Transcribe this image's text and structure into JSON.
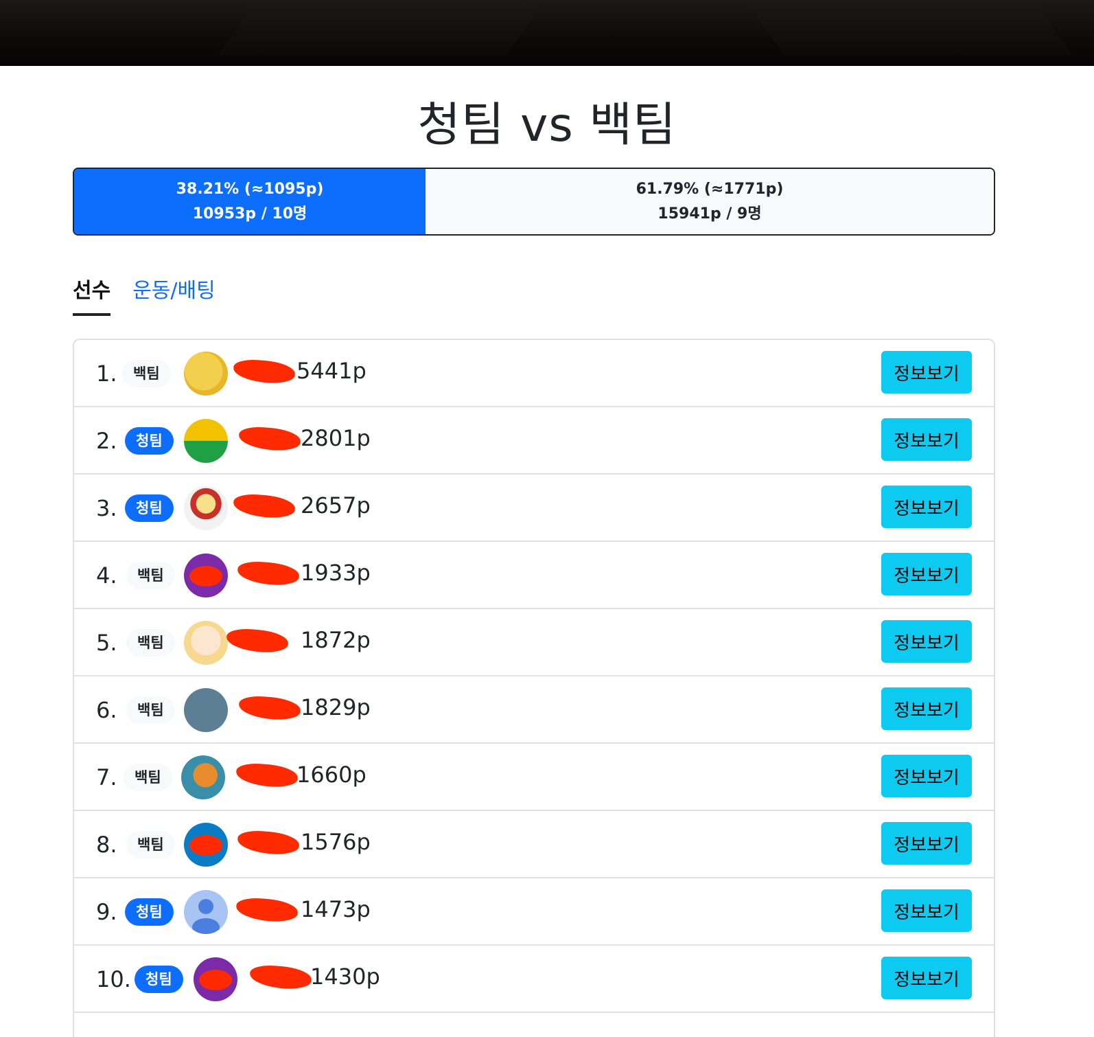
{
  "title": "청팀 vs 백팀",
  "scoreboard": {
    "blue_share_percent": 38.21,
    "blue_line1": "38.21% (≈1095p)",
    "blue_line2": "10953p / 10명",
    "white_line1": "61.79% (≈1771p)",
    "white_line2": "15941p / 9명"
  },
  "tabs": [
    {
      "label": "선수",
      "active": true
    },
    {
      "label": "운동/배팅",
      "active": false
    }
  ],
  "players": [
    {
      "rank": "1.",
      "team": "백팀",
      "points": "5441p",
      "avatar": "psyduck-avatar",
      "button": "정보보기"
    },
    {
      "rank": "2.",
      "team": "청팀",
      "points": "2801p",
      "avatar": "camera-avatar",
      "button": "정보보기"
    },
    {
      "rank": "3.",
      "team": "청팀",
      "points": "2657p",
      "avatar": "cartoon-hero-avatar",
      "button": "정보보기"
    },
    {
      "rank": "4.",
      "team": "백팀",
      "points": "1933p",
      "avatar": "purple-avatar",
      "button": "정보보기"
    },
    {
      "rank": "5.",
      "team": "백팀",
      "points": "1872p",
      "avatar": "anime-girl-avatar",
      "button": "정보보기"
    },
    {
      "rank": "6.",
      "team": "백팀",
      "points": "1829p",
      "avatar": "pixel-punk-avatar",
      "button": "정보보기"
    },
    {
      "rank": "7.",
      "team": "백팀",
      "points": "1660p",
      "avatar": "frog-avatar",
      "button": "정보보기"
    },
    {
      "rank": "8.",
      "team": "백팀",
      "points": "1576p",
      "avatar": "blue-avatar",
      "button": "정보보기"
    },
    {
      "rank": "9.",
      "team": "청팀",
      "points": "1473p",
      "avatar": "default-person-avatar",
      "button": "정보보기"
    },
    {
      "rank": "10.",
      "team": "청팀",
      "points": "1430p",
      "avatar": "purple-avatar",
      "button": "정보보기"
    }
  ],
  "colors": {
    "blue_team": "#0d6efd",
    "info_button": "#0dcaf0",
    "redaction": "#ff2a00"
  }
}
